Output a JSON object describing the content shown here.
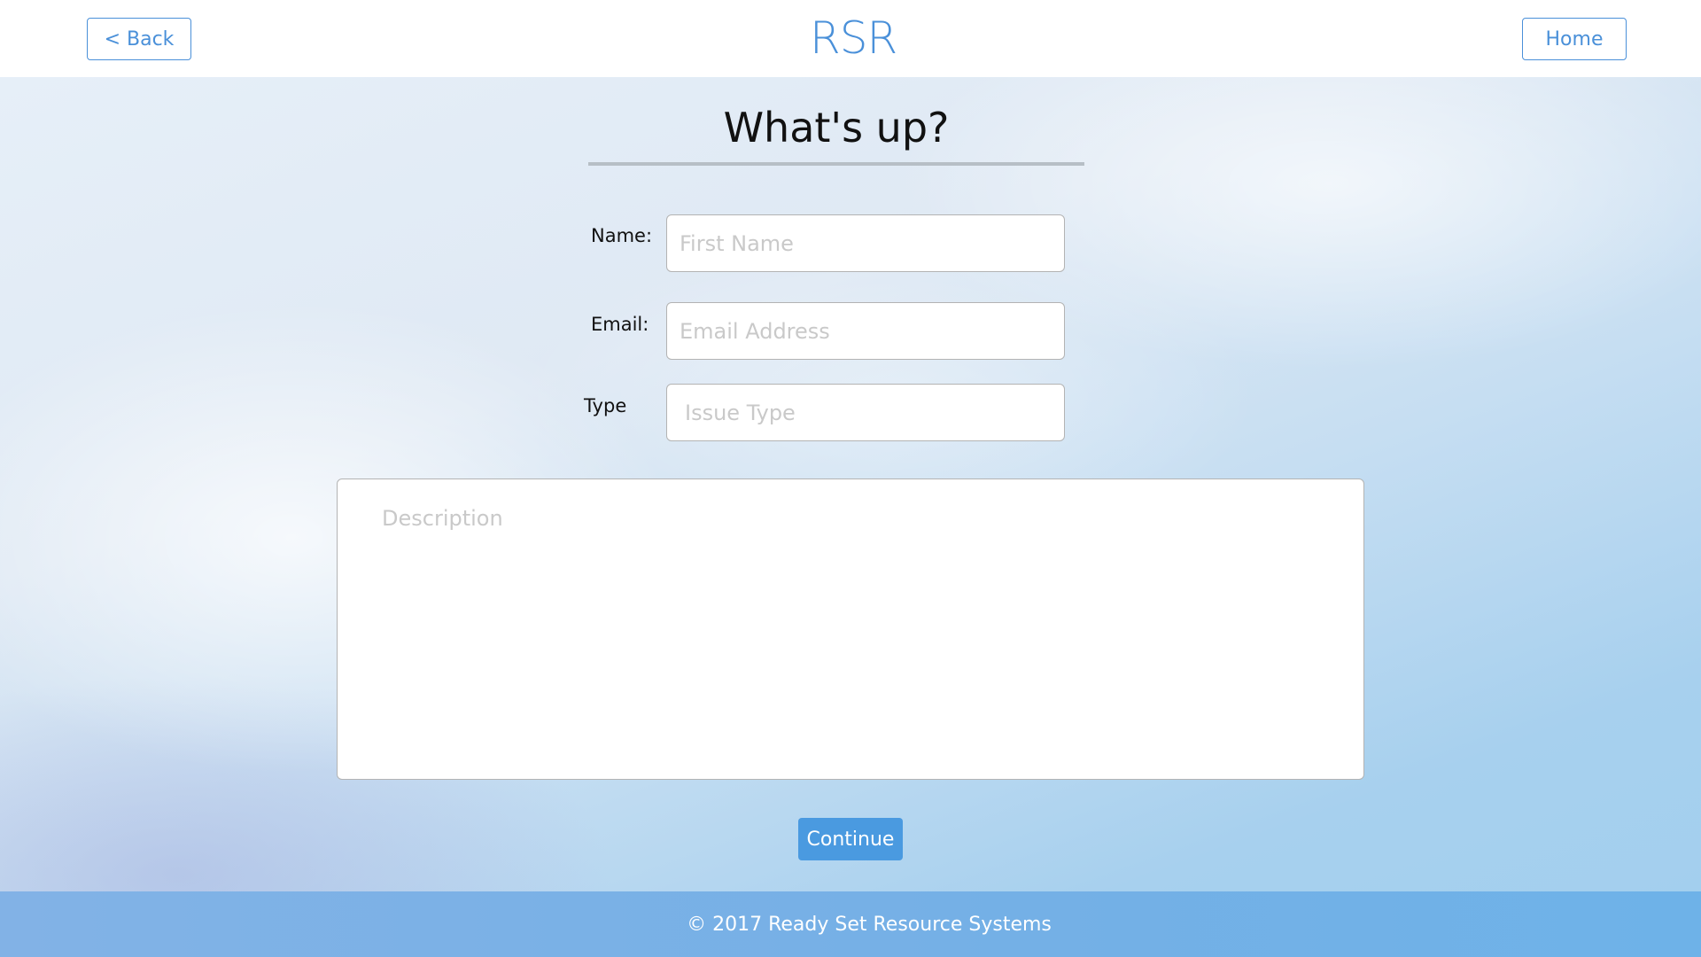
{
  "header": {
    "back_label": "< Back",
    "logo_text": "RSR",
    "home_label": "Home"
  },
  "main": {
    "title": "What's up?",
    "fields": {
      "name": {
        "label": "Name:",
        "placeholder": "First Name",
        "value": ""
      },
      "email": {
        "label": "Email:",
        "placeholder": "Email Address",
        "value": ""
      },
      "type": {
        "label": "Type",
        "placeholder": "Issue Type",
        "value": ""
      },
      "description": {
        "placeholder": "Description",
        "value": ""
      }
    },
    "continue_label": "Continue"
  },
  "footer": {
    "copyright": "© 2017 Ready Set Resource Systems"
  },
  "colors": {
    "accent": "#4a90d9",
    "continue_button": "#4a9ae0",
    "footer_bg": "#74b0e6"
  }
}
